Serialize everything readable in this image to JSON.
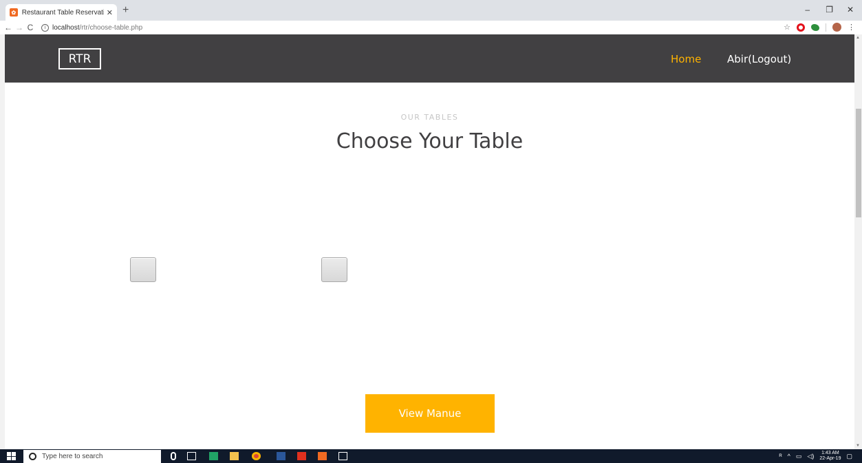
{
  "browser": {
    "tab_title": "Restaurant Table Reservation Sys",
    "tab_close": "✕",
    "new_tab": "+",
    "url_host": "localhost",
    "url_path": "/rtr/choose-table.php",
    "minimize": "–",
    "restore": "❐",
    "close": "✕"
  },
  "navbar": {
    "brand": "RTR",
    "links": [
      {
        "label": "Home",
        "active": true
      },
      {
        "label": "Abir(Logout)",
        "active": false
      }
    ]
  },
  "section": {
    "subheading": "OUR TABLES",
    "heading": "Choose Your Table"
  },
  "tables": [
    {
      "checked": false
    },
    {
      "checked": false
    }
  ],
  "view_button": "View Manue",
  "taskbar": {
    "search_placeholder": "Type here to search",
    "time": "1:43 AM",
    "date": "22-Apr-19"
  },
  "colors": {
    "navbar_bg": "#414042",
    "accent": "#ffb300",
    "heading": "#414042"
  }
}
